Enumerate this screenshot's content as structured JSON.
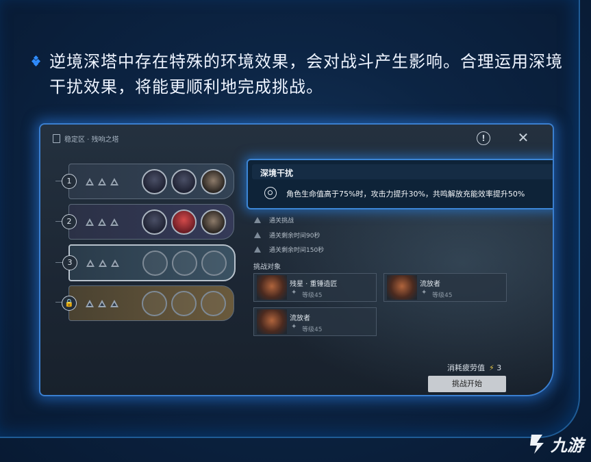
{
  "tip": {
    "text": "逆境深塔中存在特殊的环境效果，会对战斗产生影响。合理运用深境干扰效果，将能更顺利地完成挑战。"
  },
  "panel": {
    "breadcrumb": "稳定区 · 残响之塔",
    "floors": [
      {
        "number": "1",
        "locked": false
      },
      {
        "number": "2",
        "locked": false
      },
      {
        "number": "3",
        "locked": false
      },
      {
        "number": "",
        "locked": true
      }
    ],
    "tooltip": {
      "title": "深境干扰",
      "description": "角色生命值高于75%时，攻击力提升30%，共鸣解放充能效率提升50%"
    },
    "conditions": [
      "通关挑战",
      "通关剩余时间90秒",
      "通关剩余时间150秒"
    ],
    "targets_label": "挑战对象",
    "enemies": [
      {
        "name": "残星 · 重锤造匠",
        "level": "等级45"
      },
      {
        "name": "流放者",
        "level": "等级45"
      },
      {
        "name": "流放者",
        "level": "等级45"
      }
    ],
    "cost_label": "消耗疲劳值",
    "cost_value": "3",
    "start_button": "挑战开始"
  },
  "watermark": {
    "text": "九游"
  },
  "colors": {
    "accent": "#3c86d6",
    "frame": "#1f5c96",
    "bolt": "#e7c948"
  }
}
